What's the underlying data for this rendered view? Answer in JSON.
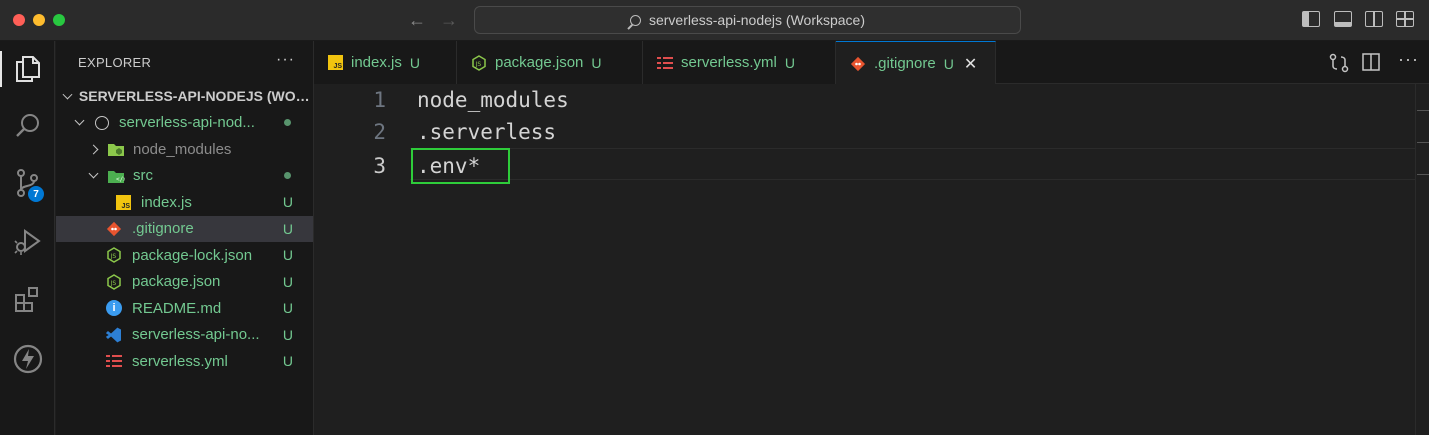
{
  "window": {
    "title": "serverless-api-nodejs (Workspace)"
  },
  "activity": {
    "scm_badge": "7"
  },
  "explorer": {
    "header": "EXPLORER",
    "more": "···",
    "workspace_root": "SERVERLESS-API-NODEJS (WOR...",
    "folder_root": "serverless-api-nod...",
    "items": [
      {
        "label": "node_modules",
        "status": ""
      },
      {
        "label": "src",
        "status": ""
      },
      {
        "label": "index.js",
        "status": "U"
      },
      {
        "label": ".gitignore",
        "status": "U"
      },
      {
        "label": "package-lock.json",
        "status": "U"
      },
      {
        "label": "package.json",
        "status": "U"
      },
      {
        "label": "README.md",
        "status": "U"
      },
      {
        "label": "serverless-api-no...",
        "status": "U"
      },
      {
        "label": "serverless.yml",
        "status": "U"
      }
    ]
  },
  "tabs": [
    {
      "label": "index.js",
      "status": "U"
    },
    {
      "label": "package.json",
      "status": "U"
    },
    {
      "label": "serverless.yml",
      "status": "U"
    },
    {
      "label": ".gitignore",
      "status": "U",
      "close": "✕"
    }
  ],
  "editor": {
    "lines": [
      {
        "number": "1",
        "text": "node_modules"
      },
      {
        "number": "2",
        "text": ".serverless"
      },
      {
        "number": "3",
        "text": ".env*"
      }
    ]
  },
  "colors": {
    "accent": "#0078d4",
    "git_untracked": "#73c991",
    "highlight_box": "#2ecc3a",
    "js_icon": "#f1c40f",
    "git_icon": "#e8542f",
    "yml_icon": "#e04e4e",
    "node_icon": "#8cc84b",
    "info_icon": "#3b9cf0",
    "vscode_icon": "#2d7fd4"
  }
}
